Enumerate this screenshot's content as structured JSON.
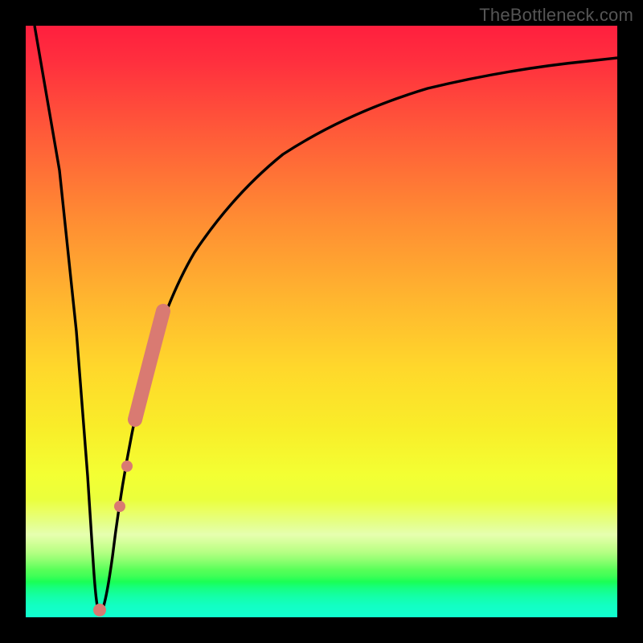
{
  "watermark": "TheBottleneck.com",
  "chart_data": {
    "type": "line",
    "title": "",
    "xlabel": "",
    "ylabel": "",
    "xlim": [
      0,
      100
    ],
    "ylim": [
      0,
      100
    ],
    "grid": false,
    "legend": false,
    "series": [
      {
        "name": "bottleneck-curve",
        "x": [
          1.5,
          4,
          6.5,
          9,
          11,
          12.5,
          15,
          18,
          22,
          28,
          35,
          45,
          58,
          72,
          86,
          100
        ],
        "y": [
          100,
          70,
          40,
          12,
          0.8,
          1.5,
          15,
          32,
          50,
          63,
          72,
          79,
          84,
          88,
          90.5,
          92
        ]
      }
    ],
    "markers": [
      {
        "name": "highlight-dot",
        "x": 12.3,
        "y": 1.0,
        "r": 7
      },
      {
        "name": "highlight-dot",
        "x": 15.8,
        "y": 18.5,
        "r": 6
      },
      {
        "name": "highlight-dot",
        "x": 17.0,
        "y": 25.0,
        "r": 6
      },
      {
        "name": "highlight-band-start",
        "x": 18.4,
        "y": 33.0,
        "r": 9
      },
      {
        "name": "highlight-band-end",
        "x": 22.6,
        "y": 51.5,
        "r": 9
      }
    ],
    "colors": {
      "curve": "#000000",
      "marker": "#d97a72",
      "gradient_top": "#ff1f3e",
      "gradient_mid": "#ffd82b",
      "gradient_bottom": "#11ffd0"
    }
  }
}
